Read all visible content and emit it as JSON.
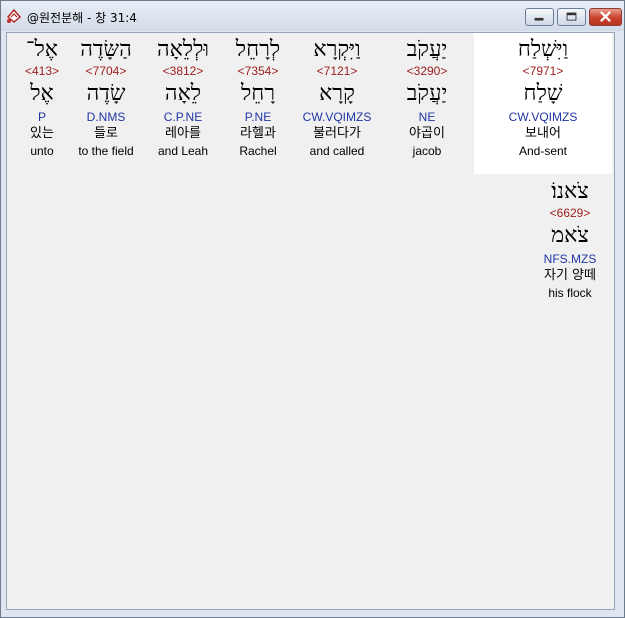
{
  "window": {
    "title": "@원전분해 - 창 31:4"
  },
  "colors": {
    "strong": "#9c1c1c",
    "parse": "#2136a6"
  },
  "words": [
    {
      "hebrew": "וַיִּשְׁלַח",
      "strong": "<7971>",
      "lemma": "שָׁלַח",
      "parse": "CW.VQIMZS",
      "korean": "보내어",
      "english": "And-sent"
    },
    {
      "hebrew": "יַעֲקֹב",
      "strong": "<3290>",
      "lemma": "יַעֲקֹב",
      "parse": "NE",
      "korean": "야곱이",
      "english": "jacob"
    },
    {
      "hebrew": "וַיִּקְרָא",
      "strong": "<7121>",
      "lemma": "קָרָא",
      "parse": "CW.VQIMZS",
      "korean": "불러다가",
      "english": "and called"
    },
    {
      "hebrew": "לְרָחֵל",
      "strong": "<7354>",
      "lemma": "רָחֵל",
      "parse": "P.NE",
      "korean": "라헬과",
      "english": "Rachel"
    },
    {
      "hebrew": "וּלְלֵאָה",
      "strong": "<3812>",
      "lemma": "לֵאָה",
      "parse": "C.P.NE",
      "korean": "레아를",
      "english": "and Leah"
    },
    {
      "hebrew": "הַשָּׂדֶה",
      "strong": "<7704>",
      "lemma": "שָׂדֶה",
      "parse": "D.NMS",
      "korean": "들로",
      "english": "to the field"
    },
    {
      "hebrew": "אֶל־",
      "strong": "<413>",
      "lemma": "אֶל",
      "parse": "P",
      "korean": "있는",
      "english": "unto"
    },
    {
      "hebrew": "צֹאנוֹ׃",
      "strong": "<6629>",
      "lemma": "צֹאמ",
      "parse": "NFS.MZS",
      "korean": "자기 양떼",
      "english": "his flock"
    }
  ]
}
